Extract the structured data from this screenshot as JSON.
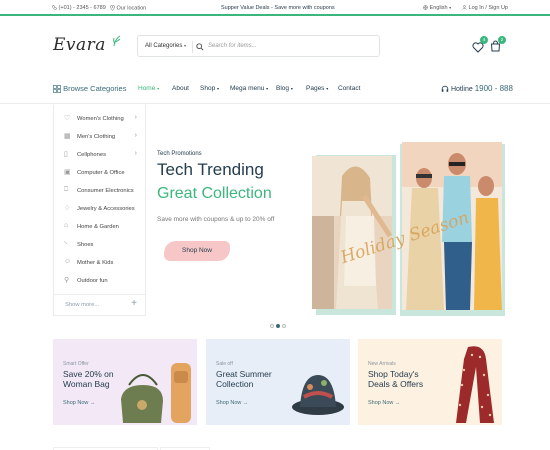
{
  "topbar": {
    "phone": "(+01) - 2345 - 6789",
    "location": "Our location",
    "promo": "Supper Value Deals - Save more with coupons",
    "language": "English",
    "login": "Log In / Sign Up"
  },
  "header": {
    "logo": "Evara",
    "search_category": "All Categories",
    "search_placeholder": "Search for items...",
    "wishlist_count": "4",
    "cart_count": "2"
  },
  "nav": {
    "browse": "Browse Categories",
    "items": [
      "Home",
      "About",
      "Shop",
      "Mega menu",
      "Blog",
      "Pages",
      "Contact"
    ],
    "hotline_label": "Hotline",
    "hotline_number": "1900 - 888"
  },
  "categories": {
    "items": [
      {
        "label": "Women's Clothing",
        "icon": "dress-icon",
        "submenu": true
      },
      {
        "label": "Men's Clothing",
        "icon": "shirt-icon",
        "submenu": true
      },
      {
        "label": "Cellphones",
        "icon": "phone-icon",
        "submenu": true
      },
      {
        "label": "Computer & Office",
        "icon": "computer-icon",
        "submenu": false
      },
      {
        "label": "Consumer Electronics",
        "icon": "electronics-icon",
        "submenu": false
      },
      {
        "label": "Jewelry & Accessories",
        "icon": "jewelry-icon",
        "submenu": false
      },
      {
        "label": "Home & Garden",
        "icon": "home-icon",
        "submenu": false
      },
      {
        "label": "Shoes",
        "icon": "shoe-icon",
        "submenu": false
      },
      {
        "label": "Mother & Kids",
        "icon": "baby-icon",
        "submenu": false
      },
      {
        "label": "Outdoor fun",
        "icon": "outdoor-icon",
        "submenu": false
      }
    ],
    "show_more": "Show more..."
  },
  "hero": {
    "subtitle": "Tech Promotions",
    "title1": "Tech Trending",
    "title2": "Great Collection",
    "desc": "Save more with coupons & up to 20% off",
    "cta": "Shop Now",
    "overlay_script": "Holiday Season",
    "slide_count": 3,
    "active_slide": 2
  },
  "banners": [
    {
      "small": "Smart Offer",
      "title": "Save 20% on Woman Bag",
      "link": "Shop Now"
    },
    {
      "small": "Sale off",
      "title": "Great Summer Collection",
      "link": "Shop Now"
    },
    {
      "small": "New Arrivals",
      "title": "Shop Today's Deals & Offers",
      "link": "Shop Now"
    }
  ],
  "colors": {
    "accent": "#3bb77e",
    "dark": "#253d4e",
    "cta_pink": "#f7c7c7"
  }
}
